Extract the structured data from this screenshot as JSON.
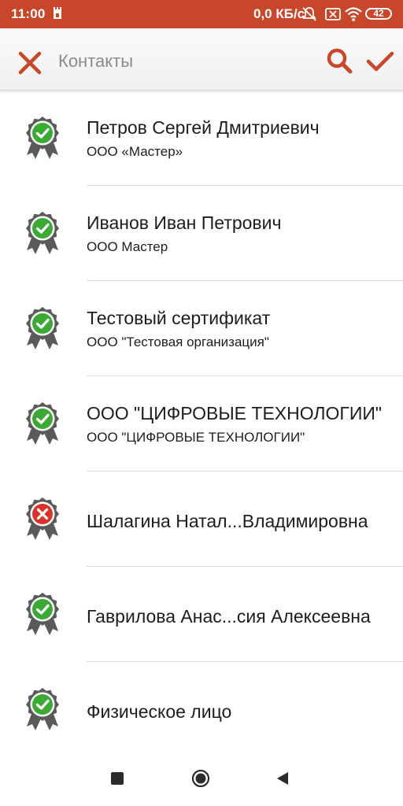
{
  "status_bar": {
    "time": "11:00",
    "network_speed": "0,0 КБ/с",
    "battery": "42"
  },
  "header": {
    "title": "Контакты",
    "icons": [
      "close-icon",
      "search-icon",
      "check-icon"
    ]
  },
  "colors": {
    "accent": "#c8472b",
    "valid_badge": "#3aaa35",
    "invalid_badge": "#d8342b",
    "ribbon": "#5a5a5a"
  },
  "contacts": [
    {
      "name": "Петров Сергей Дмитриевич",
      "org": "ООО «Мастер»",
      "status": "valid"
    },
    {
      "name": "Иванов Иван Петрович",
      "org": "ООО Мастер",
      "status": "valid"
    },
    {
      "name": "Тестовый сертификат",
      "org": "ООО \"Тестовая организация\"",
      "status": "valid"
    },
    {
      "name": "ООО \"ЦИФРОВЫЕ ТЕХНОЛОГИИ\"",
      "org": "ООО \"ЦИФРОВЫЕ ТЕХНОЛОГИИ\"",
      "status": "valid"
    },
    {
      "name": "Шалагина Натал...Владимировна",
      "org": "",
      "status": "invalid"
    },
    {
      "name": "Гаврилова Анас...сия Алексеевна",
      "org": "",
      "status": "valid"
    },
    {
      "name": "Физическое лицо",
      "org": "",
      "status": "valid"
    }
  ],
  "nav_bar": {
    "icons": [
      "recent-apps-icon",
      "home-icon",
      "back-icon"
    ]
  }
}
